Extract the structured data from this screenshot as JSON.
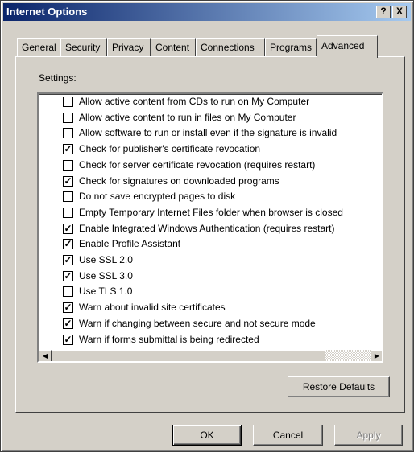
{
  "window": {
    "title": "Internet Options",
    "help_label": "?",
    "close_label": "X"
  },
  "tabs": [
    {
      "label": "General",
      "active": false
    },
    {
      "label": "Security",
      "active": false
    },
    {
      "label": "Privacy",
      "active": false
    },
    {
      "label": "Content",
      "active": false
    },
    {
      "label": "Connections",
      "active": false
    },
    {
      "label": "Programs",
      "active": false
    },
    {
      "label": "Advanced",
      "active": true
    }
  ],
  "settings": {
    "label": "Settings:",
    "items": [
      {
        "label": "Allow active content from CDs to run on My Computer",
        "checked": false
      },
      {
        "label": "Allow active content to run in files on My Computer",
        "checked": false
      },
      {
        "label": "Allow software to run or install even if the signature is invalid",
        "checked": false
      },
      {
        "label": "Check for publisher's certificate revocation",
        "checked": true
      },
      {
        "label": "Check for server certificate revocation (requires restart)",
        "checked": false
      },
      {
        "label": "Check for signatures on downloaded programs",
        "checked": true
      },
      {
        "label": "Do not save encrypted pages to disk",
        "checked": false
      },
      {
        "label": "Empty Temporary Internet Files folder when browser is closed",
        "checked": false
      },
      {
        "label": "Enable Integrated Windows Authentication (requires restart)",
        "checked": true
      },
      {
        "label": "Enable Profile Assistant",
        "checked": true
      },
      {
        "label": "Use SSL 2.0",
        "checked": true
      },
      {
        "label": "Use SSL 3.0",
        "checked": true
      },
      {
        "label": "Use TLS 1.0",
        "checked": false
      },
      {
        "label": "Warn about invalid site certificates",
        "checked": true
      },
      {
        "label": "Warn if changing between secure and not secure mode",
        "checked": true
      },
      {
        "label": "Warn if forms submittal is being redirected",
        "checked": true
      }
    ]
  },
  "buttons": {
    "restore_defaults": "Restore Defaults",
    "ok": "OK",
    "cancel": "Cancel",
    "apply": "Apply"
  },
  "colors": {
    "title_start": "#0a246a",
    "title_end": "#a6caf0",
    "face": "#d4d0c8"
  }
}
